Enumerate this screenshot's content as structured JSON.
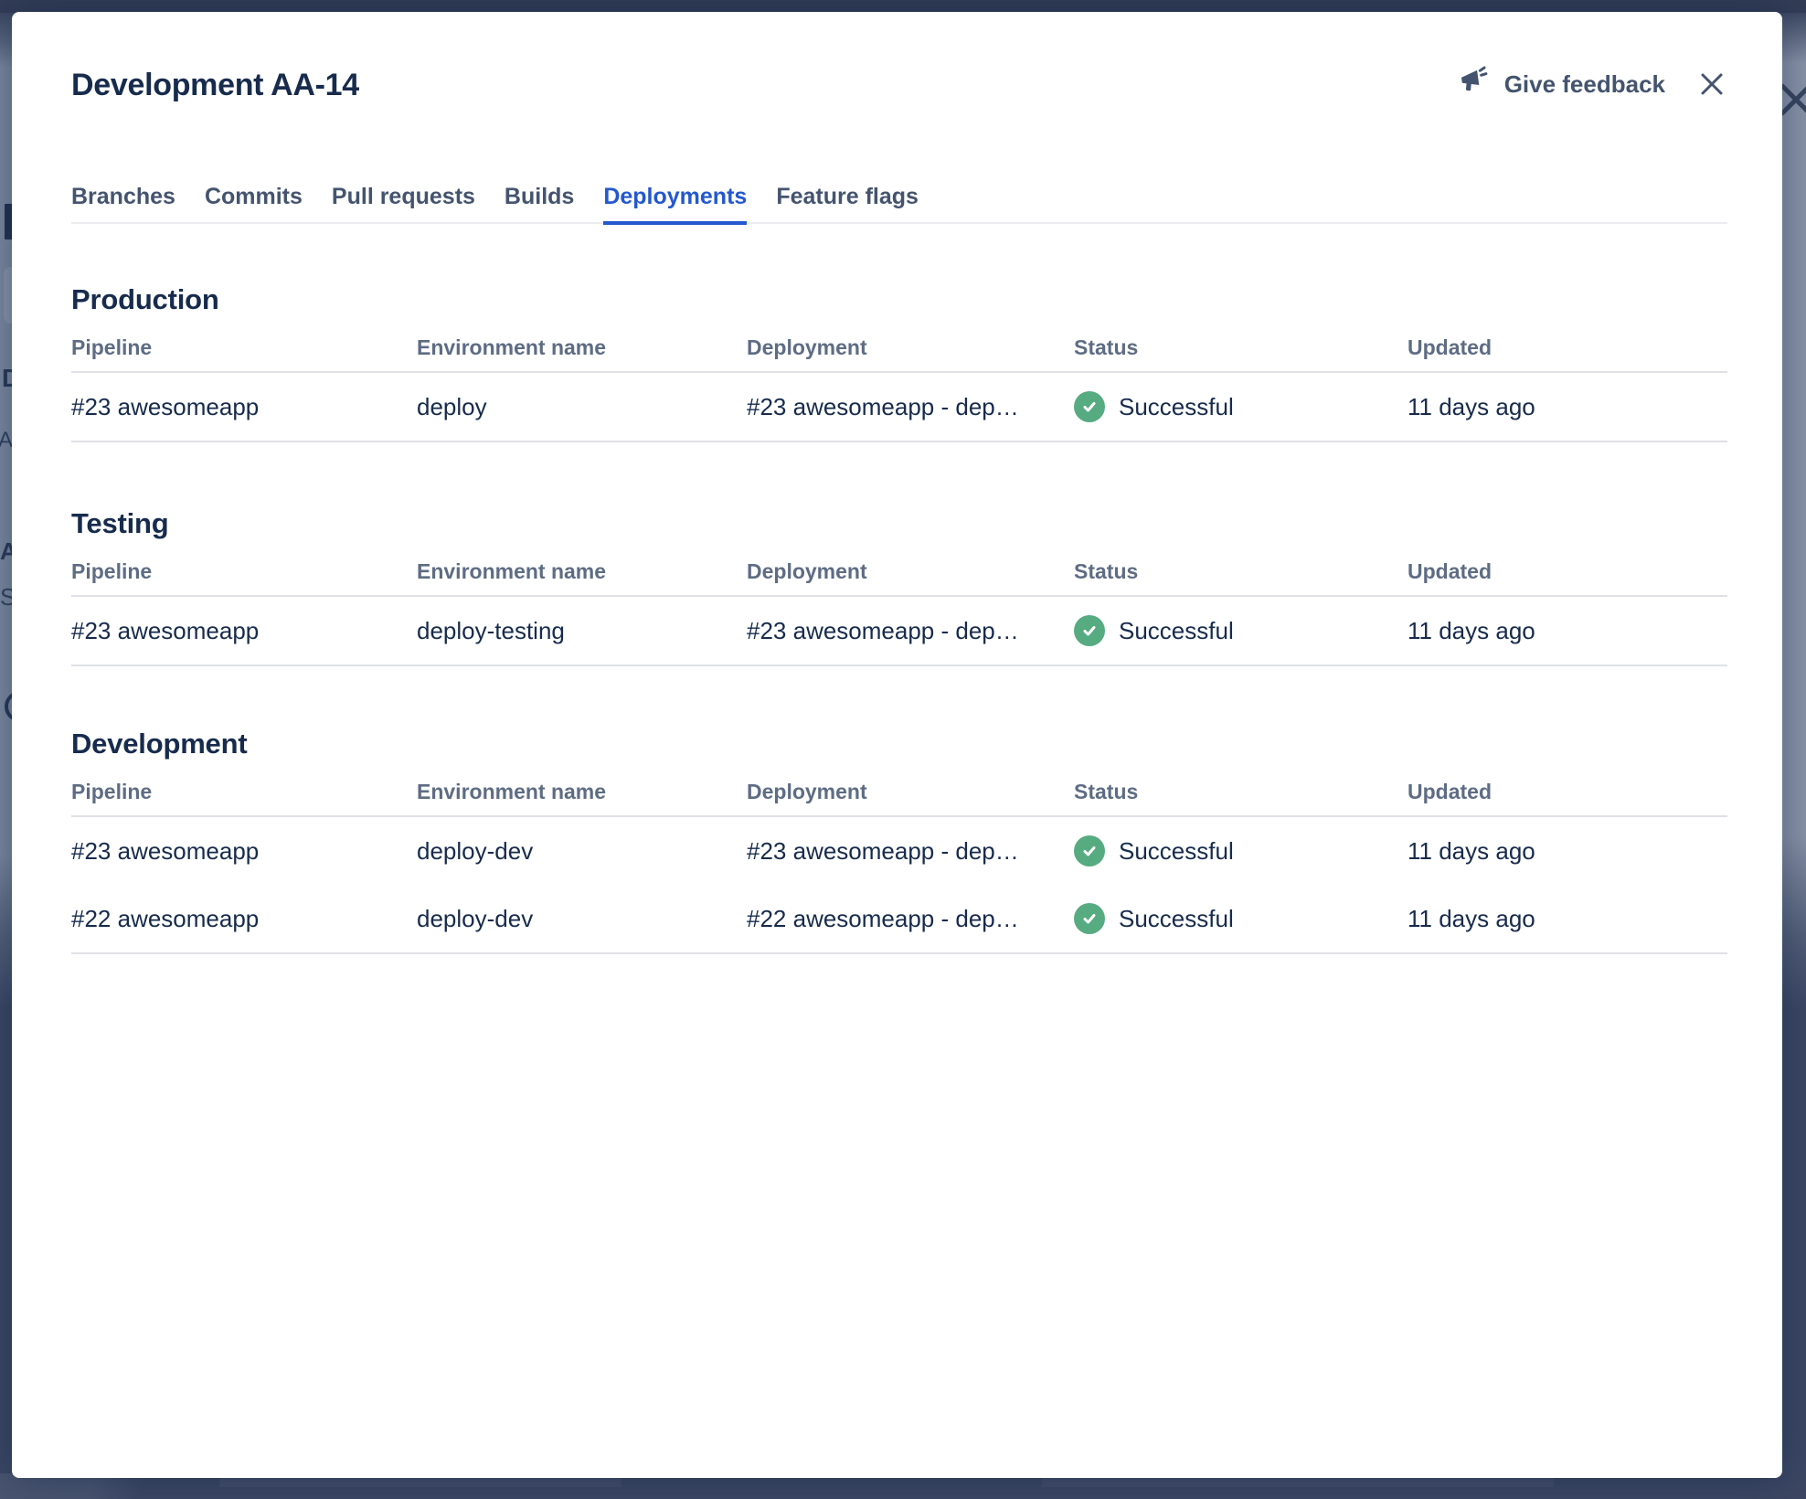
{
  "modal": {
    "title": "Development AA-14",
    "feedback_button": {
      "label": "Give feedback",
      "icon": "megaphone-icon"
    },
    "close_button": {
      "icon": "close-icon"
    },
    "tabs": [
      "Branches",
      "Commits",
      "Pull requests",
      "Builds",
      "Deployments",
      "Feature flags"
    ],
    "active_tab": "Deployments",
    "table_columns": [
      "Pipeline",
      "Environment name",
      "Deployment",
      "Status",
      "Updated"
    ],
    "sections": [
      {
        "heading": "Production",
        "rows": [
          {
            "pipeline": "#23 awesomeapp",
            "environment": "deploy",
            "deployment": "#23 awesomeapp - dep…",
            "status": "Successful",
            "status_icon": "check-circle-icon",
            "updated": "11 days ago"
          }
        ]
      },
      {
        "heading": "Testing",
        "rows": [
          {
            "pipeline": "#23 awesomeapp",
            "environment": "deploy-testing",
            "deployment": "#23 awesomeapp - dep…",
            "status": "Successful",
            "status_icon": "check-circle-icon",
            "updated": "11 days ago"
          }
        ]
      },
      {
        "heading": "Development",
        "rows": [
          {
            "pipeline": "#23 awesomeapp",
            "environment": "deploy-dev",
            "deployment": "#23 awesomeapp - dep…",
            "status": "Successful",
            "status_icon": "check-circle-icon",
            "updated": "11 days ago"
          },
          {
            "pipeline": "#22 awesomeapp",
            "environment": "deploy-dev",
            "deployment": "#22 awesomeapp - dep…",
            "status": "Successful",
            "status_icon": "check-circle-icon",
            "updated": "11 days ago"
          }
        ]
      }
    ]
  },
  "background": {
    "page_fragment_letters": {
      "d": "D",
      "a1": "A",
      "a2": "A",
      "s": "S"
    },
    "close_icon": "close-icon"
  },
  "colors": {
    "link_blue": "#2458CF",
    "active_tab_blue": "#2458CF",
    "success_green": "#57AB81",
    "text_dark": "#172B4D",
    "text_muted": "#44546F",
    "column_header_gray": "#5E6C84",
    "divider_gray": "#DFE1E6",
    "overlay_navy": "#3C4763",
    "overlay_light_area": "#7E8AA0",
    "top_bar_navy": "#333D56"
  }
}
